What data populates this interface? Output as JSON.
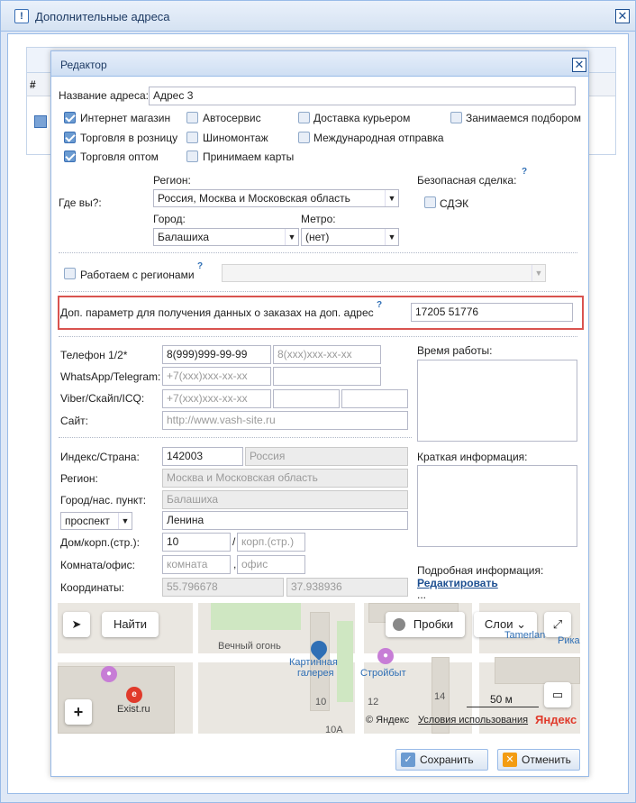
{
  "outer": {
    "title": "Дополнительные адреса",
    "grid_col_hash": "#"
  },
  "editor": {
    "title": "Редактор",
    "address_name_label": "Название адреса:",
    "address_name_value": "Адрес 3",
    "categories": [
      {
        "label": "Интернет магазин",
        "checked": true
      },
      {
        "label": "Автосервис",
        "checked": false
      },
      {
        "label": "Доставка курьером",
        "checked": false
      },
      {
        "label": "Занимаемся подбором",
        "checked": false
      },
      {
        "label": "Торговля в розницу",
        "checked": true
      },
      {
        "label": "Шиномонтаж",
        "checked": false
      },
      {
        "label": "Международная отправка",
        "checked": false
      },
      {
        "label": "Торговля оптом",
        "checked": true
      },
      {
        "label": "Принимаем карты",
        "checked": false
      }
    ],
    "where_label": "Где вы?:",
    "region_label": "Регион:",
    "region_value": "Россия, Москва и Московская область",
    "city_label": "Город:",
    "city_value": "Балашиха",
    "metro_label": "Метро:",
    "metro_value": "(нет)",
    "safe_deal_label": "Безопасная сделка:",
    "help_mark": "?",
    "cdek_label": "СДЭК",
    "regions_label": "Работаем с регионами",
    "extra_param_label": "Доп. параметр для получения данных о заказах на доп. адрес",
    "extra_param_value": "17205 51776",
    "phone_label": "Телефон 1/2*",
    "phone1": "8(999)999-99-99",
    "phone2_ph": "8(xxx)xxx-xx-xx",
    "whatsapp_label": "WhatsApp/Telegram:",
    "whatsapp_ph": "+7(xxx)xxx-xx-xx",
    "viber_label": "Viber/Скайп/ICQ:",
    "viber_ph": "+7(xxx)xxx-xx-xx",
    "site_label": "Сайт:",
    "site_ph": "http://www.vash-site.ru",
    "work_time_label": "Время работы:",
    "brief_label": "Краткая информация:",
    "index_label": "Индекс/Страна:",
    "index_value": "142003",
    "country_value": "Россия",
    "region2_label": "Регион:",
    "region2_value": "Москва и Московская область",
    "city2_label": "Город/нас. пункт:",
    "city2_value": "Балашиха",
    "street_type": "проспект",
    "street_value": "Ленина",
    "house_label": "Дом/корп.(стр.):",
    "house_value": "10",
    "slash": "/",
    "korp_ph": "корп.(стр.)",
    "room_label": "Комната/офис:",
    "room_ph": "комната",
    "comma": ",",
    "office_ph": "офис",
    "coords_label": "Координаты:",
    "lat": "55.796678",
    "lon": "37.938936",
    "detail_label": "Подробная информация:",
    "edit_link": "Редактировать",
    "ellipsis": "...",
    "save_label": "Сохранить",
    "cancel_label": "Отменить"
  },
  "map": {
    "find_label": "Найти",
    "traffic_label": "Пробки",
    "layers_label": "Слои",
    "poi_eternal_flame": "Вечный огонь",
    "poi_gallery_1": "Картинная",
    "poi_gallery_2": "галерея",
    "poi_stroybyt": "Стройбыт",
    "poi_tamerlan": "Tamerlan",
    "poi_rica": "Рика",
    "poi_exist": "Exist.ru",
    "house_10": "10",
    "house_12": "12",
    "house_14": "14",
    "house_10a": "10А",
    "scale": "50 м",
    "copyright": "© Яндекс",
    "terms": "Условия использования",
    "logo": "Яндекс"
  }
}
